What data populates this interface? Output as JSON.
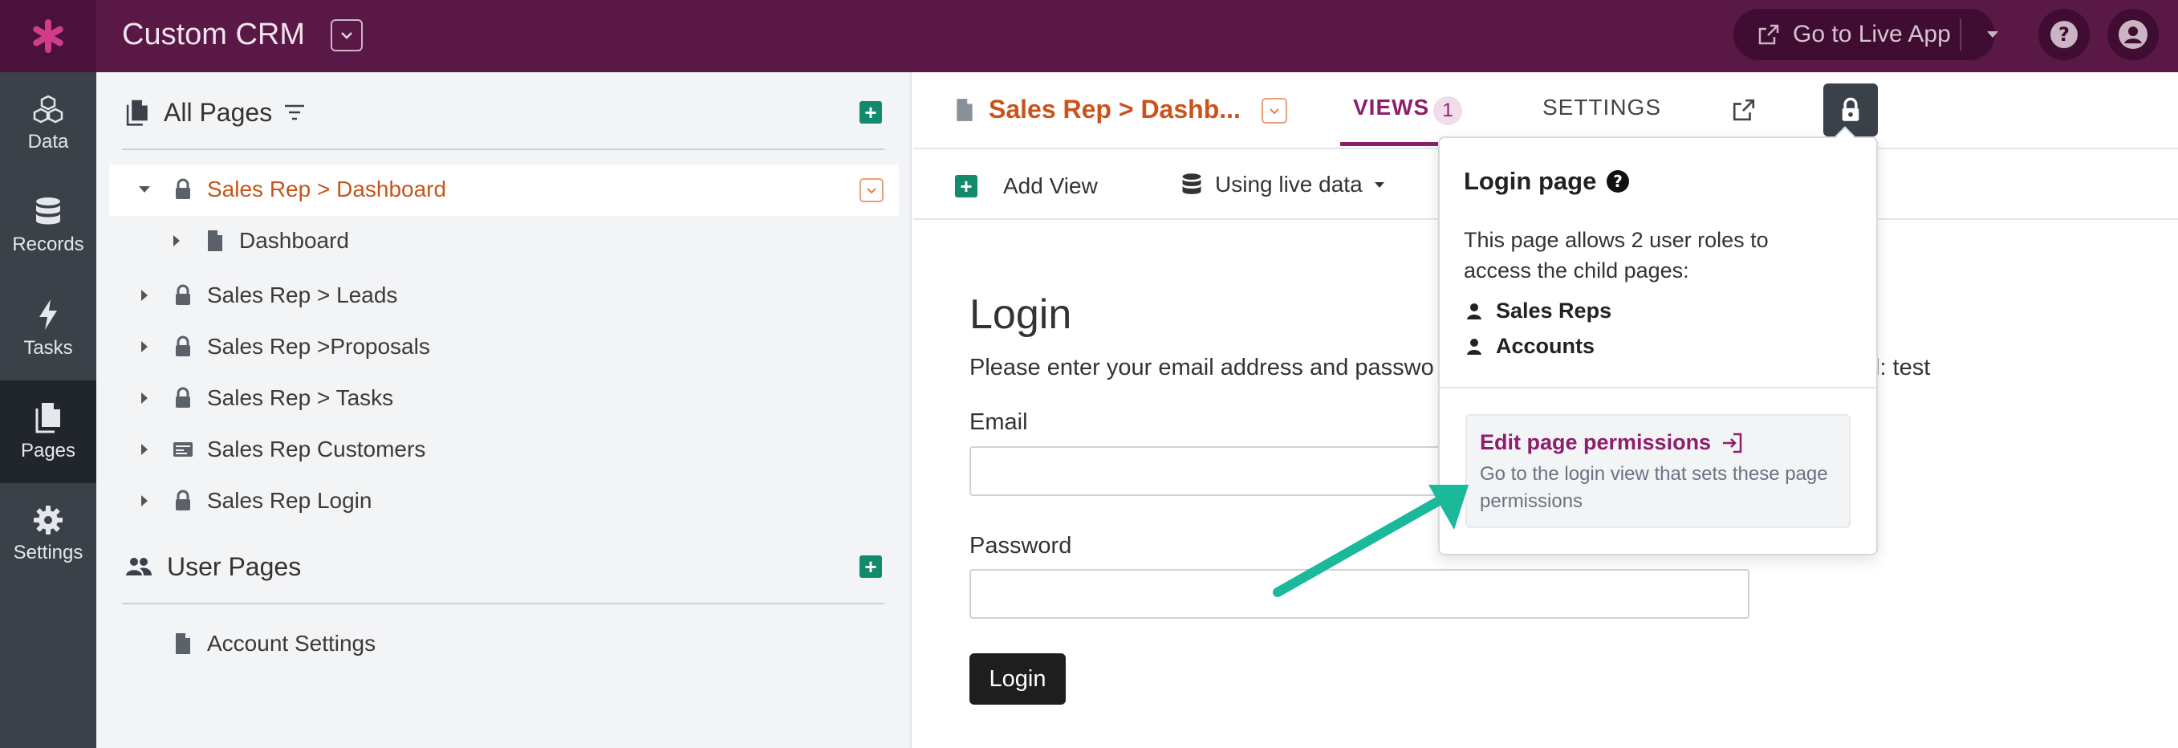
{
  "app": {
    "title": "Custom CRM",
    "go_live_label": "Go to Live App",
    "brand_color": "#5a1846",
    "accent_color": "#8c1f6c",
    "logo_icon": "asterisk-icon"
  },
  "rail": {
    "items": [
      {
        "label": "Data",
        "icon": "cubes-icon"
      },
      {
        "label": "Records",
        "icon": "database-icon"
      },
      {
        "label": "Tasks",
        "icon": "bolt-icon"
      },
      {
        "label": "Pages",
        "icon": "pages-icon",
        "active": true
      },
      {
        "label": "Settings",
        "icon": "gear-icon"
      }
    ]
  },
  "sidebar": {
    "all_pages_title": "All Pages",
    "user_pages_title": "User Pages",
    "tree": [
      {
        "label": "Sales Rep > Dashboard",
        "icon": "lock-icon",
        "selected": true,
        "expanded": true
      },
      {
        "label": "Dashboard",
        "icon": "page-icon",
        "child": true
      },
      {
        "label": "Sales Rep > Leads",
        "icon": "lock-icon"
      },
      {
        "label": "Sales Rep >Proposals",
        "icon": "lock-icon"
      },
      {
        "label": "Sales Rep > Tasks",
        "icon": "lock-icon"
      },
      {
        "label": "Sales Rep Customers",
        "icon": "card-icon"
      },
      {
        "label": "Sales Rep Login",
        "icon": "lock-icon"
      }
    ],
    "user_pages": [
      {
        "label": "Account Settings",
        "icon": "page-icon"
      }
    ]
  },
  "header": {
    "page_crumb": "Sales Rep > Dashb...",
    "tabs": {
      "views": "VIEWS",
      "views_count": "1",
      "settings": "SETTINGS"
    }
  },
  "toolbar": {
    "add_view": "Add View",
    "data_source": "Using live data"
  },
  "login_view": {
    "title": "Login",
    "subtitle": "Please enter your email address and passwo",
    "subtitle_tail": "l: test",
    "email_label": "Email",
    "password_label": "Password",
    "button": "Login"
  },
  "popover": {
    "title": "Login page",
    "description": "This page allows 2 user roles to access the child pages:",
    "roles": [
      "Sales Reps",
      "Accounts"
    ],
    "edit_link": "Edit page permissions",
    "edit_desc": "Go to the login view that sets these page permissions"
  },
  "annotation_color": "#1ab99a"
}
